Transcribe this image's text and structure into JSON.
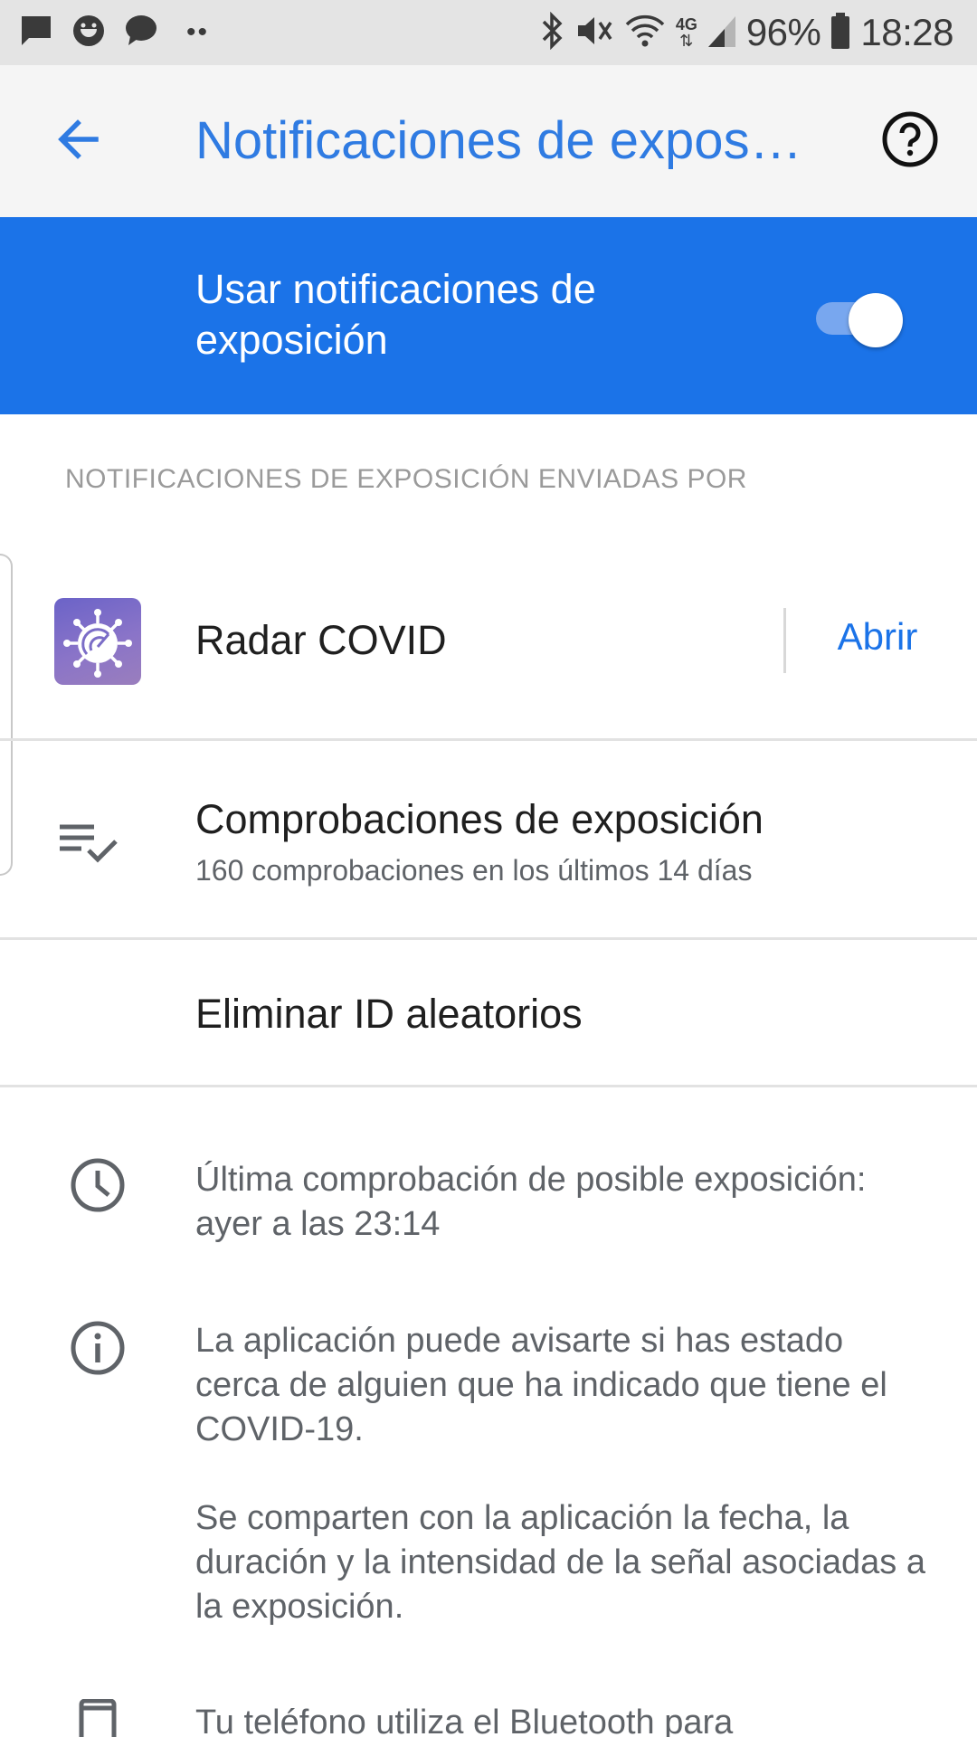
{
  "status_bar": {
    "battery": "96%",
    "time": "18:28",
    "network": "4G",
    "left_icons": [
      "message-icon",
      "smiley-icon",
      "chat-bubble-icon"
    ],
    "right_icons": [
      "bluetooth-icon",
      "mute-icon",
      "wifi-icon",
      "signal-icon",
      "battery-icon"
    ]
  },
  "app_bar": {
    "title": "Notificaciones de expos…",
    "back_icon": "arrow-left-icon",
    "help_icon": "help-circle-icon"
  },
  "master_toggle": {
    "label": "Usar notificaciones de exposición",
    "enabled": true
  },
  "section": {
    "header": "NOTIFICACIONES DE EXPOSICIÓN ENVIADAS POR"
  },
  "app_row": {
    "name": "Radar COVID",
    "action": "Abrir"
  },
  "checks_row": {
    "title": "Comprobaciones de exposición",
    "subtitle": "160 comprobaciones en los últimos 14 días"
  },
  "delete_row": {
    "label": "Eliminar ID aleatorios"
  },
  "info": {
    "last_check": "Última comprobación de posible exposición: ayer a las 23:14",
    "app_notice": "La aplicación puede avisarte si has estado cerca de alguien que ha indicado que tiene el COVID-19.",
    "shared_data": "Se comparten con la aplicación la fecha, la duración y la intensidad de la señal asociadas a la exposición.",
    "bluetooth": "Tu teléfono utiliza el Bluetooth para"
  },
  "colors": {
    "accent": "#1b73e8",
    "title": "#2f7be2",
    "status_bar_bg": "#e4e4e4",
    "app_bar_bg": "#f5f5f5"
  }
}
